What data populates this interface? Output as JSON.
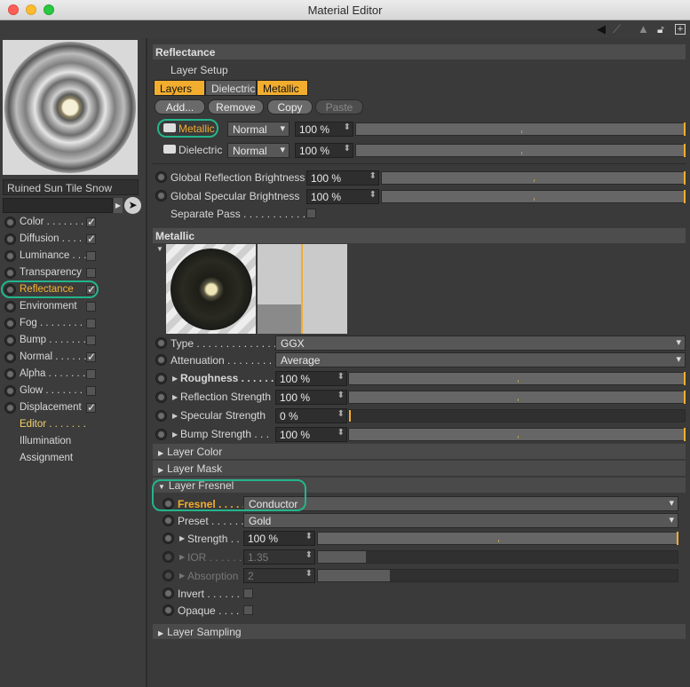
{
  "window": {
    "title": "Material Editor"
  },
  "toolbar_icons": [
    "arrow-left-icon",
    "arrow-right-icon",
    "arrow-up-icon",
    "lock-icon",
    "new-window-icon"
  ],
  "material": {
    "name": "Ruined Sun Tile Snow"
  },
  "channels": [
    {
      "label": "Color . . . . . . .",
      "checked": true
    },
    {
      "label": "Diffusion . . . .",
      "checked": true
    },
    {
      "label": "Luminance . . .",
      "checked": false
    },
    {
      "label": "Transparency",
      "checked": false
    },
    {
      "label": "Reflectance",
      "checked": true,
      "active": true
    },
    {
      "label": "Environment",
      "checked": false
    },
    {
      "label": "Fog . . . . . . . . .",
      "checked": false
    },
    {
      "label": "Bump . . . . . . .",
      "checked": false
    },
    {
      "label": "Normal . . . . . .",
      "checked": true
    },
    {
      "label": "Alpha . . . . . . .",
      "checked": false
    },
    {
      "label": "Glow . . . . . . . .",
      "checked": false
    },
    {
      "label": "Displacement",
      "checked": true
    }
  ],
  "nav": [
    {
      "label": "Editor . . . . . . .",
      "active": true
    },
    {
      "label": "Illumination",
      "active": false
    },
    {
      "label": "Assignment",
      "active": false
    }
  ],
  "reflectance": {
    "header": "Reflectance",
    "layer_setup": "Layer Setup",
    "tabs": [
      "Layers",
      "Dielectric",
      "Metallic"
    ],
    "buttons": [
      "Add...",
      "Remove",
      "Copy",
      "Paste"
    ],
    "layers": [
      {
        "name": "Metallic",
        "mode": "Normal",
        "value": "100 %"
      },
      {
        "name": "Dielectric",
        "mode": "Normal",
        "value": "100 %"
      }
    ],
    "global_reflection_label": "Global Reflection Brightness",
    "global_reflection_value": "100 %",
    "global_specular_label": "Global Specular Brightness",
    "global_specular_value": "100 %",
    "separate_pass_label": "Separate Pass . . . . . . . . . . . ."
  },
  "metallic": {
    "header": "Metallic",
    "type_label": "Type . . . . . . . . . . . . . .",
    "type_value": "GGX",
    "attenuation_label": "Attenuation . . . . . . . . .",
    "attenuation_value": "Average",
    "roughness_label": "Roughness . . . . . .",
    "roughness_value": "100 %",
    "reflection_strength_label": "Reflection Strength",
    "reflection_strength_value": "100 %",
    "specular_strength_label": "Specular Strength",
    "specular_strength_value": "0 %",
    "bump_strength_label": "Bump Strength . . .",
    "bump_strength_value": "100 %"
  },
  "sections": {
    "layer_color": "Layer Color",
    "layer_mask": "Layer Mask",
    "layer_fresnel": "Layer Fresnel",
    "layer_sampling": "Layer Sampling"
  },
  "fresnel": {
    "fresnel_label": "Fresnel . . . . .",
    "fresnel_value": "Conductor",
    "preset_label": "Preset . . . . . . . .",
    "preset_value": "Gold",
    "strength_label": "Strength . .",
    "strength_value": "100 %",
    "ior_label": "IOR . . . . . .",
    "ior_value": "1.35",
    "absorption_label": "Absorption",
    "absorption_value": "2",
    "invert_label": "Invert . . . . . .",
    "opaque_label": "Opaque . . . ."
  },
  "colors": {
    "accent": "#f2ad2f",
    "highlight": "#23b58c",
    "panel": "#3a3a3a"
  }
}
